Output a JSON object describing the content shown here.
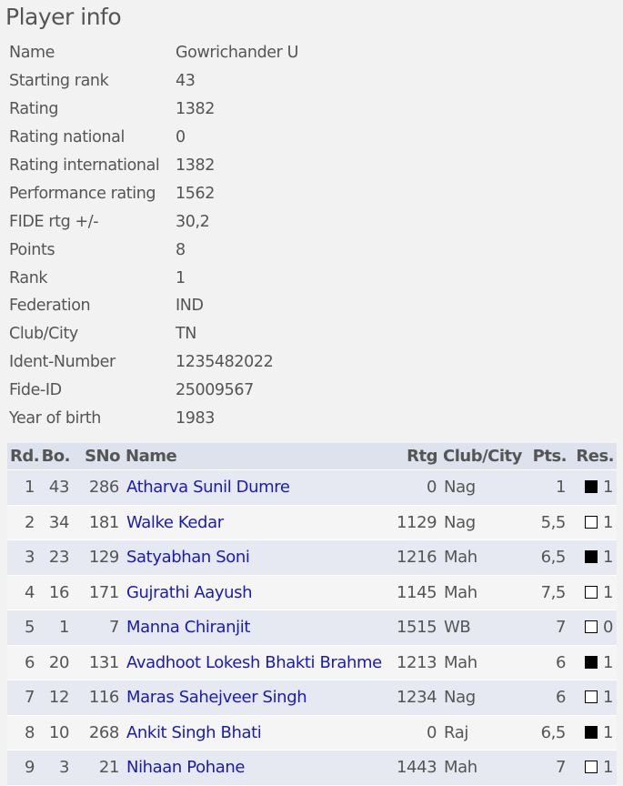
{
  "title": "Player info",
  "info": [
    [
      "Name",
      "Gowrichander U"
    ],
    [
      "Starting rank",
      "43"
    ],
    [
      "Rating",
      "1382"
    ],
    [
      "Rating national",
      "0"
    ],
    [
      "Rating international",
      "1382"
    ],
    [
      "Performance rating",
      "1562"
    ],
    [
      "FIDE rtg +/-",
      "30,2"
    ],
    [
      "Points",
      "8"
    ],
    [
      "Rank",
      "1"
    ],
    [
      "Federation",
      "IND"
    ],
    [
      "Club/City",
      "TN"
    ],
    [
      "Ident-Number",
      "1235482022"
    ],
    [
      "Fide-ID",
      "25009567"
    ],
    [
      "Year of birth",
      "1983"
    ]
  ],
  "headers": [
    "Rd.",
    "Bo.",
    "SNo",
    "Name",
    "Rtg",
    "Club/City",
    "Pts.",
    "Res."
  ],
  "rows": [
    {
      "rd": "1",
      "bo": "43",
      "sno": "286",
      "name": "Atharva Sunil Dumre",
      "rtg": "0",
      "club": "Nag",
      "pts": "1",
      "color": "black",
      "res": "1"
    },
    {
      "rd": "2",
      "bo": "34",
      "sno": "181",
      "name": "Walke Kedar",
      "rtg": "1129",
      "club": "Nag",
      "pts": "5,5",
      "color": "white",
      "res": "1"
    },
    {
      "rd": "3",
      "bo": "23",
      "sno": "129",
      "name": "Satyabhan Soni",
      "rtg": "1216",
      "club": "Mah",
      "pts": "6,5",
      "color": "black",
      "res": "1"
    },
    {
      "rd": "4",
      "bo": "16",
      "sno": "171",
      "name": "Gujrathi Aayush",
      "rtg": "1145",
      "club": "Mah",
      "pts": "7,5",
      "color": "white",
      "res": "1"
    },
    {
      "rd": "5",
      "bo": "1",
      "sno": "7",
      "name": "Manna Chiranjit",
      "rtg": "1515",
      "club": "WB",
      "pts": "7",
      "color": "white",
      "res": "0"
    },
    {
      "rd": "6",
      "bo": "20",
      "sno": "131",
      "name": "Avadhoot Lokesh Bhakti Brahme",
      "rtg": "1213",
      "club": "Mah",
      "pts": "6",
      "color": "black",
      "res": "1"
    },
    {
      "rd": "7",
      "bo": "12",
      "sno": "116",
      "name": "Maras Sahejveer Singh",
      "rtg": "1234",
      "club": "Nag",
      "pts": "6",
      "color": "white",
      "res": "1"
    },
    {
      "rd": "8",
      "bo": "10",
      "sno": "268",
      "name": "Ankit Singh Bhati",
      "rtg": "0",
      "club": "Raj",
      "pts": "6,5",
      "color": "black",
      "res": "1"
    },
    {
      "rd": "9",
      "bo": "3",
      "sno": "21",
      "name": "Nihaan Pohane",
      "rtg": "1443",
      "club": "Mah",
      "pts": "7",
      "color": "white",
      "res": "1"
    }
  ]
}
